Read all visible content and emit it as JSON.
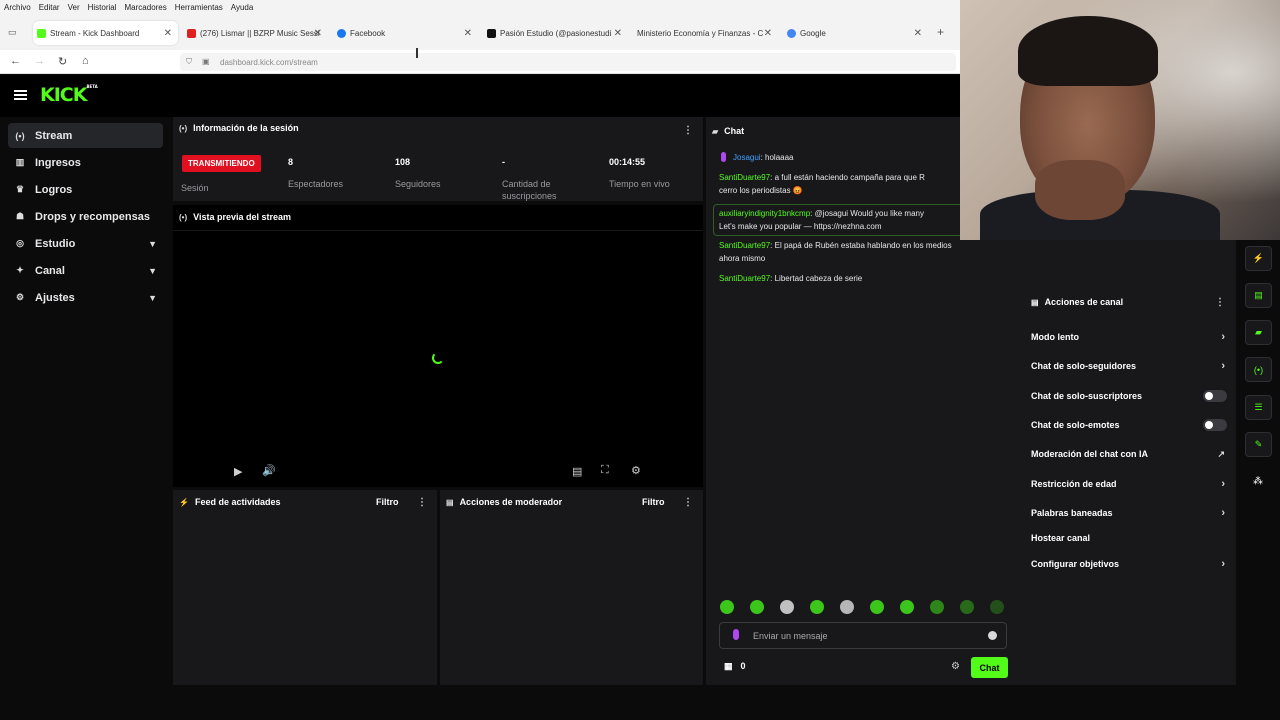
{
  "browser": {
    "menu": [
      "Archivo",
      "Editar",
      "Ver",
      "Historial",
      "Marcadores",
      "Herramientas",
      "Ayuda"
    ],
    "tabs": [
      {
        "label": "Stream - Kick Dashboard",
        "color": "#53fc18"
      },
      {
        "label": "(276) Lismar || BZRP Music Sessi",
        "color": "#e02020"
      },
      {
        "label": "Facebook",
        "color": "#1877f2"
      },
      {
        "label": "Pasión Estudio (@pasionestudi",
        "color": "#111111"
      },
      {
        "label": "Ministerio Economía y Finanzas - C",
        "color": "#ffffff"
      },
      {
        "label": "Google",
        "color": "#4285f4"
      }
    ],
    "url": "dashboard.kick.com/stream"
  },
  "app": {
    "logo": "KICK",
    "logo_sup": "BETA",
    "sidebar": [
      {
        "label": "Stream",
        "icon": "broadcast-icon"
      },
      {
        "label": "Ingresos",
        "icon": "chart-icon"
      },
      {
        "label": "Logros",
        "icon": "trophy-icon"
      },
      {
        "label": "Drops y recompensas",
        "icon": "gift-icon"
      },
      {
        "label": "Estudio",
        "icon": "studio-icon"
      },
      {
        "label": "Canal",
        "icon": "channel-icon"
      },
      {
        "label": "Ajustes",
        "icon": "gear-icon"
      }
    ],
    "session": {
      "title": "Información de la sesión",
      "live_badge": "TRANSMITIENDO",
      "session_label": "Sesión",
      "stats": [
        {
          "value": "8",
          "label": "Espectadores"
        },
        {
          "value": "108",
          "label": "Seguidores"
        },
        {
          "value": "-",
          "label": "Cantidad de suscripciones"
        },
        {
          "value": "00:14:55",
          "label": "Tiempo en vivo"
        }
      ]
    },
    "preview": {
      "title": "Vista previa del stream"
    },
    "feed": {
      "title": "Feed de actividades",
      "filter": "Filtro"
    },
    "mod_actions": {
      "title": "Acciones de moderador",
      "filter": "Filtro"
    },
    "chat": {
      "title": "Chat",
      "messages": [
        {
          "user": "Josagui",
          "text": ": holaaaa",
          "blue": true
        },
        {
          "user": "SantiDuarte97",
          "text": ": a full están haciendo campaña para que R",
          "cont": "cerro los periodistas 😡"
        },
        {
          "user": "auxiliaryindignity1bnkcmp",
          "text": ": @josagui Would you like many",
          "cont": "Let's make you popular — https://nezhna.com",
          "boxed": true
        },
        {
          "user": "SantiDuarte97",
          "text": ": El papá de Rubén estaba hablando en los medios",
          "cont": "ahora mismo"
        },
        {
          "user": "SantiDuarte97",
          "text": ": Libertad cabeza de serie"
        }
      ],
      "input_placeholder": "Enviar un mensaje",
      "points": "0",
      "send_label": "Chat"
    },
    "channel_actions": {
      "title": "Acciones de canal",
      "items": [
        {
          "label": "Modo lento",
          "type": "arrow"
        },
        {
          "label": "Chat de solo-seguidores",
          "type": "arrow"
        },
        {
          "label": "Chat de solo-suscriptores",
          "type": "toggle"
        },
        {
          "label": "Chat de solo-emotes",
          "type": "toggle"
        },
        {
          "label": "Moderación del chat con IA",
          "type": "external"
        },
        {
          "label": "Restricción de edad",
          "type": "arrow"
        },
        {
          "label": "Palabras baneadas",
          "type": "arrow"
        },
        {
          "label": "Hostear canal",
          "type": "none"
        },
        {
          "label": "Configurar objetivos",
          "type": "arrow"
        }
      ]
    },
    "accent": "#53fc18"
  }
}
